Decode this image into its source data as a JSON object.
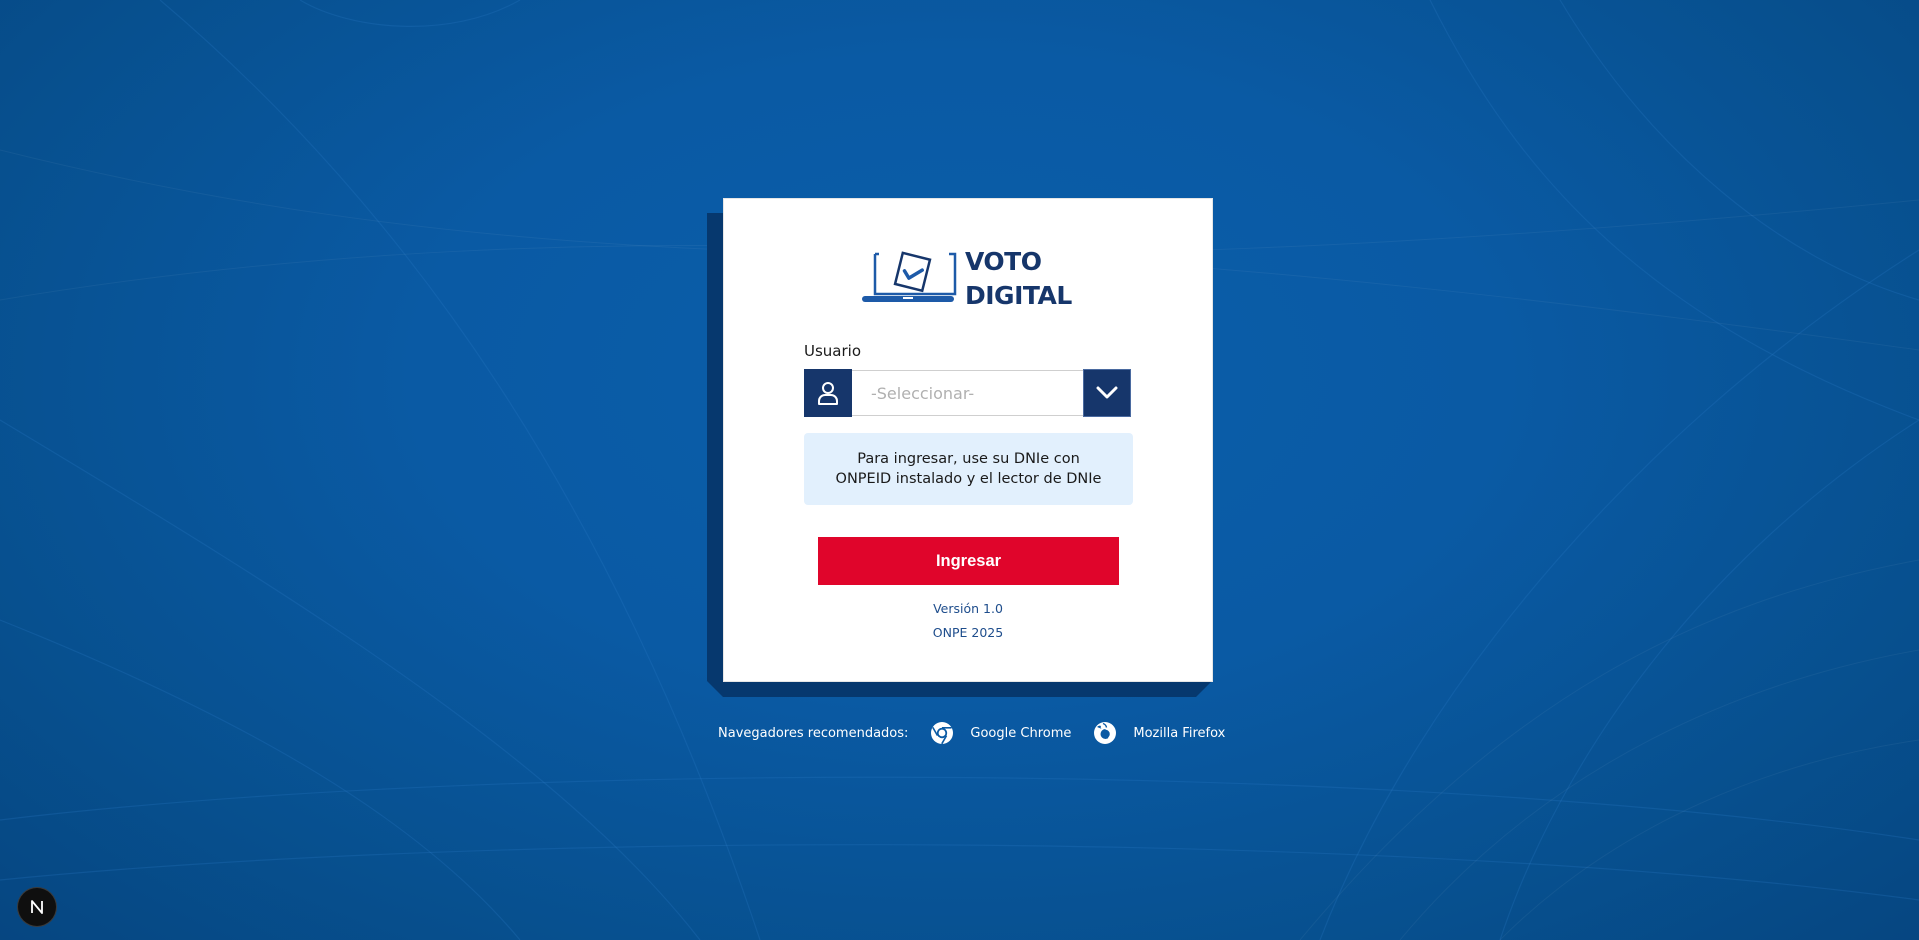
{
  "brand": {
    "line1": "VOTO",
    "line2": "DIGITAL",
    "color": "#16366b"
  },
  "form": {
    "user_label": "Usuario",
    "select_placeholder": "-Seleccionar-",
    "info_text": "Para ingresar, use su DNIe con ONPEID instalado y el lector de DNIe",
    "submit_label": "Ingresar"
  },
  "footer": {
    "version": "Versión 1.0",
    "copyright": "ONPE 2025"
  },
  "browsers": {
    "label": "Navegadores recomendados:",
    "items": [
      {
        "name": "Google Chrome",
        "icon": "chrome-icon"
      },
      {
        "name": "Mozilla Firefox",
        "icon": "firefox-icon"
      }
    ]
  },
  "dev_badge": {
    "letter": "N"
  },
  "colors": {
    "background": "#0a5aa4",
    "navy": "#16366b",
    "accent_red": "#e0052b",
    "info_bg": "#e2f0fd"
  }
}
